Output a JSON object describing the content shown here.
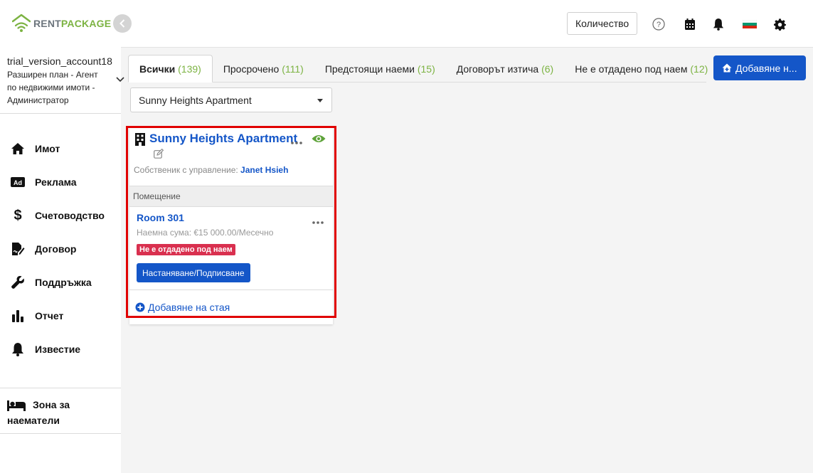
{
  "brand": {
    "name_part1": "RENT",
    "name_part2": "PACKAGE",
    "accent": "#7cb342"
  },
  "account": {
    "name": "trial_version_account18",
    "plan_line1": "Разширен план - Агент",
    "plan_line2": "по недвижими имоти -",
    "plan_line3": "Администратор"
  },
  "nav": {
    "items": [
      {
        "label": "Имот",
        "icon": "home-icon"
      },
      {
        "label": "Реклама",
        "icon": "ad-icon"
      },
      {
        "label": "Счетоводство",
        "icon": "dollar-icon"
      },
      {
        "label": "Договор",
        "icon": "contract-icon"
      },
      {
        "label": "Поддръжка",
        "icon": "wrench-icon"
      },
      {
        "label": "Отчет",
        "icon": "chart-icon"
      },
      {
        "label": "Известие",
        "icon": "bell-icon"
      }
    ],
    "tenant_zone": "Зона за наематели"
  },
  "topbar": {
    "quantity_label": "Количество"
  },
  "tabs": [
    {
      "label": "Всички",
      "count": "(139)"
    },
    {
      "label": "Просрочено",
      "count": "(111)"
    },
    {
      "label": "Предстоящи наеми",
      "count": "(15)"
    },
    {
      "label": "Договорът изтича",
      "count": "(6)"
    },
    {
      "label": "Не е отдадено под наем",
      "count": "(12)"
    }
  ],
  "add_button": "Добавяне н...",
  "property_filter": {
    "selected": "Sunny Heights Apartment"
  },
  "property_card": {
    "title": "Sunny Heights Apartment",
    "owner_label": "Собственик с управление:",
    "owner_name": "Janet Hsieh",
    "section_label": "Помещение",
    "room": {
      "name": "Room 301",
      "rent": "Наемна сума: €15 000.00/Месечно",
      "status": "Не е отдадено под наем",
      "action": "Настаняване/Подписване"
    },
    "add_room": "Добавяне на стая"
  },
  "colors": {
    "primary": "#1456c8",
    "danger": "#d9304f",
    "highlight": "#e00000"
  }
}
